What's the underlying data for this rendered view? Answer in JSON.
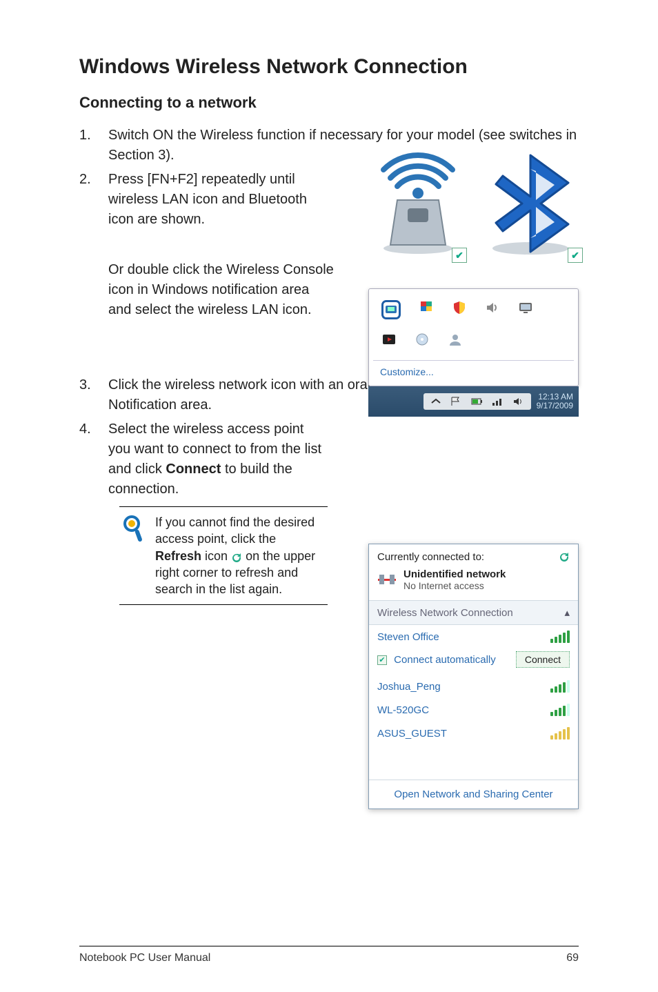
{
  "heading": "Windows Wireless Network Connection",
  "subheading": "Connecting to a network",
  "steps": {
    "s1": "Switch ON the Wireless function if necessary for your model (see switches in Section 3).",
    "s2": "Press [FN+F2] repeatedly until wireless LAN icon and Bluetooth icon are shown.",
    "s2b": "Or double click the Wireless Console icon in Windows notification area and select the wireless LAN icon.",
    "s3a": "Click the wireless network icon with an orange star ",
    "s3b": " in the Windows® Notification area.",
    "s4a": "Select the wireless access point you want to connect to from the list and click ",
    "s4bold": "Connect",
    "s4b": " to build the connection."
  },
  "note": {
    "a": "If you cannot find the desired access point, click the ",
    "bold": "Refresh",
    "b": " icon ",
    "c": " on the upper right corner to refresh and search in the list again."
  },
  "tray": {
    "customize": "Customize...",
    "time": "12:13 AM",
    "date": "9/17/2009"
  },
  "wifi_popup": {
    "currently": "Currently connected to:",
    "unid_title": "Unidentified network",
    "unid_sub": "No Internet access",
    "section": "Wireless Network Connection",
    "auto": "Connect automatically",
    "connect": "Connect",
    "items": [
      "Steven Office",
      "Joshua_Peng",
      "WL-520GC",
      "ASUS_GUEST"
    ],
    "footer": "Open Network and Sharing Center"
  },
  "footer_left": "Notebook PC User Manual",
  "footer_right": "69"
}
